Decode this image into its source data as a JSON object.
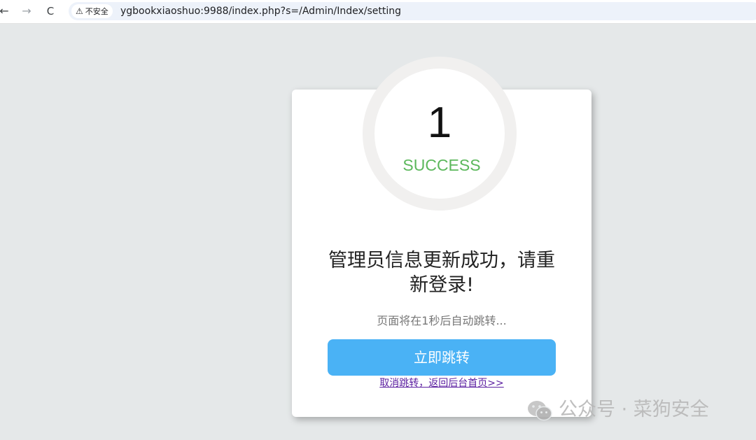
{
  "browser": {
    "back_icon": "←",
    "forward_icon": "→",
    "reload_icon": "C",
    "security_label": "不安全",
    "url": "ygbookxiaoshuo:9988/index.php?s=/Admin/Index/setting"
  },
  "dialog": {
    "countdown": "1",
    "status": "SUCCESS",
    "message": "管理员信息更新成功，请重新登录!",
    "redirect_note": "页面将在1秒后自动跳转...",
    "jump_button": "立即跳转",
    "cancel_link": "取消跳转，返回后台首页>>"
  },
  "watermark": {
    "text": "公众号 · 菜狗安全"
  },
  "colors": {
    "page_background": "#e5e8e9",
    "success_green": "#5cb85c",
    "button_blue": "#4ab2f5",
    "link_purple": "#5b1ea0"
  }
}
